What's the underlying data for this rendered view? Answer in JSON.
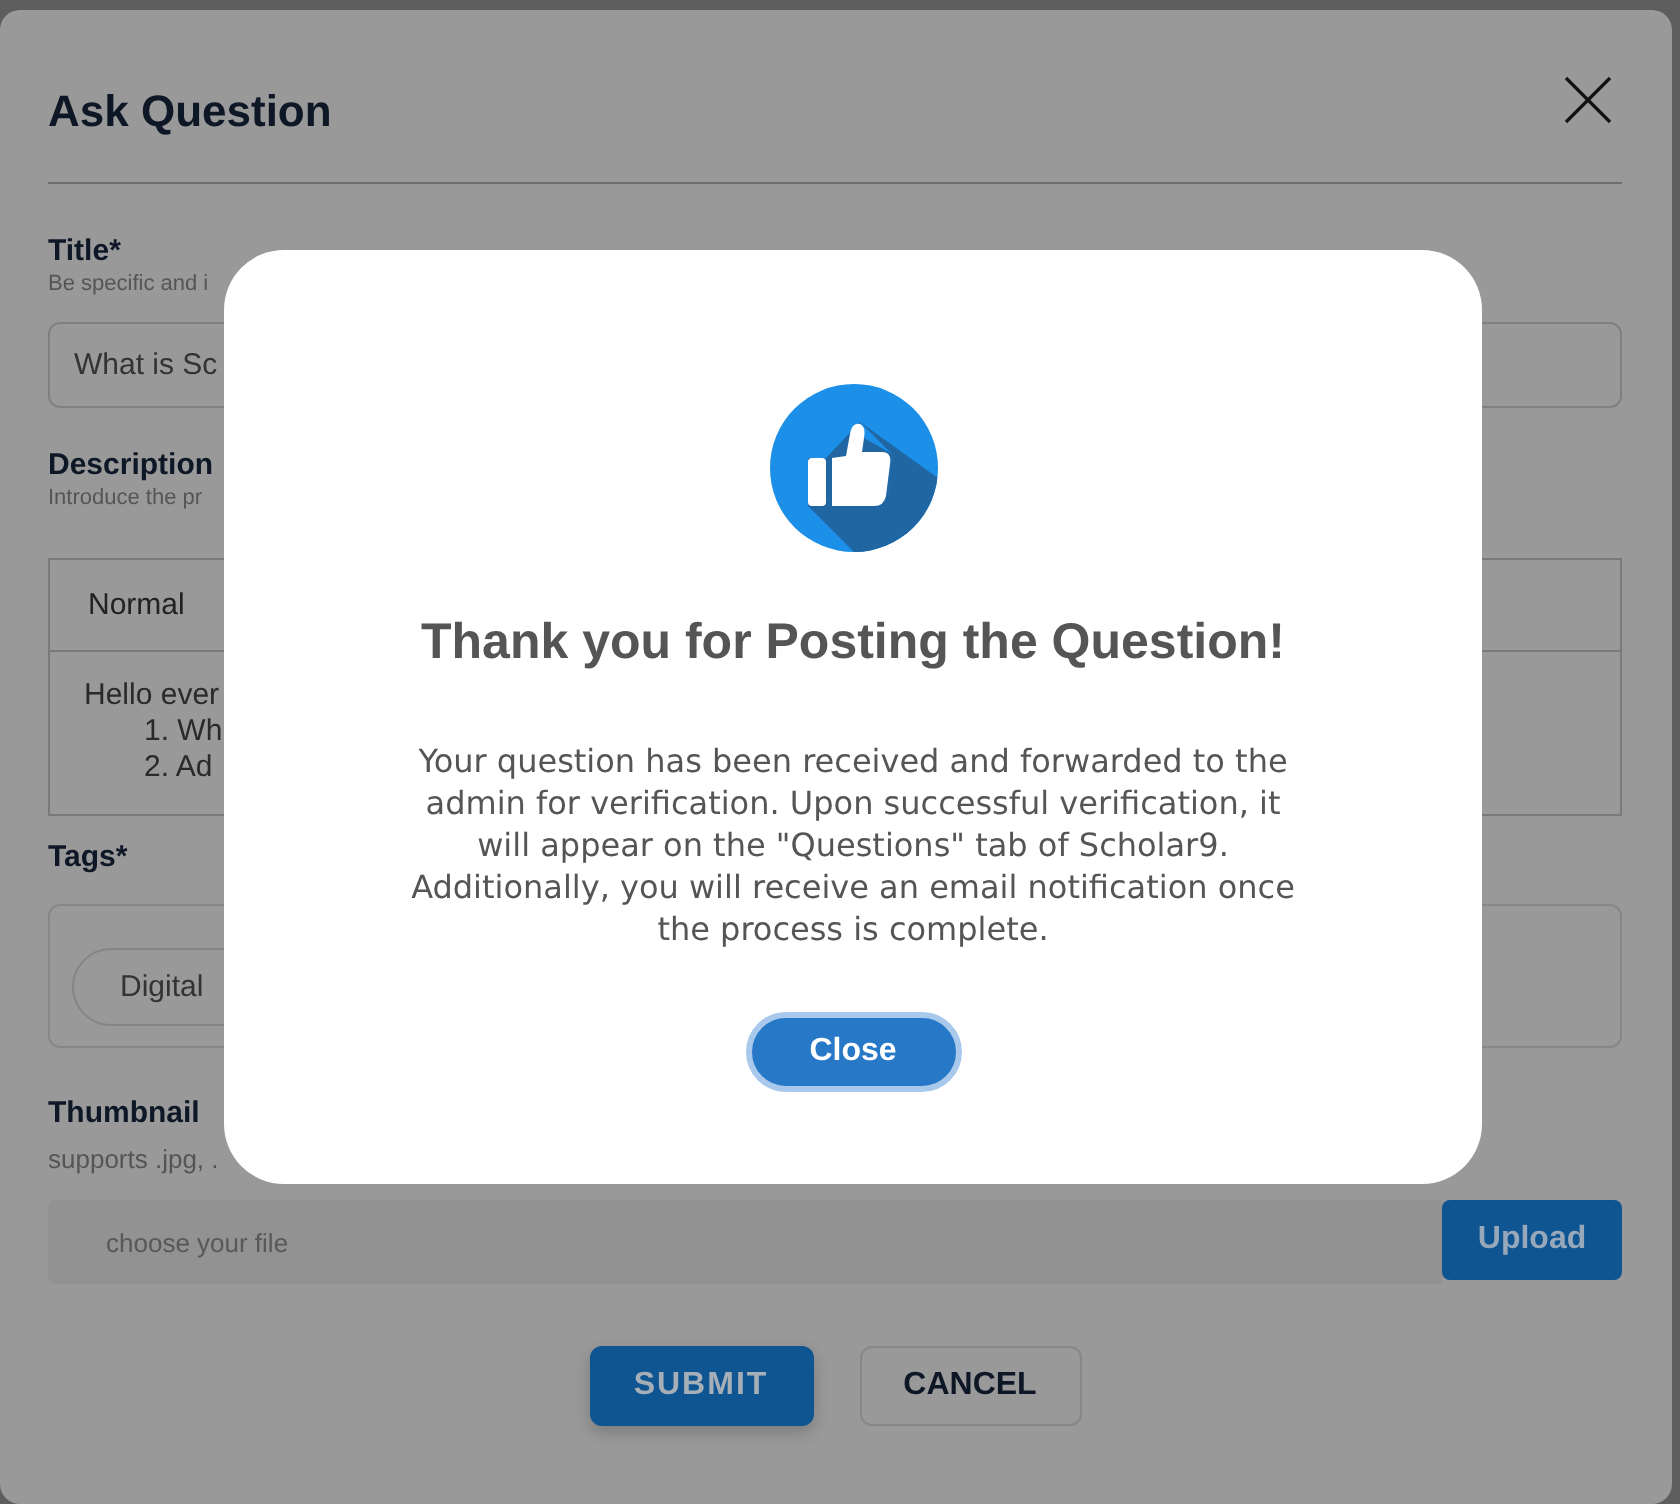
{
  "dialog": {
    "title": "Ask Question"
  },
  "title_field": {
    "label": "Title*",
    "hint": "Be specific and i",
    "value": "What is Sc"
  },
  "description_field": {
    "label": "Description",
    "hint": "Introduce the pr",
    "format": "Normal",
    "lines": [
      {
        "kind": "paragraph",
        "text": "Hello ever"
      },
      {
        "kind": "list_item",
        "text": "1. Wh"
      },
      {
        "kind": "list_item",
        "text": "2. Ad"
      }
    ]
  },
  "tags_field": {
    "label": "Tags*",
    "tags": [
      "Digital"
    ]
  },
  "thumbnail_field": {
    "label": "Thumbnail",
    "hint": "supports .jpg, .",
    "placeholder": "choose your file",
    "button": "Upload"
  },
  "actions": [
    {
      "kind": "primary",
      "label": "SUBMIT"
    },
    {
      "kind": "secondary",
      "label": "CANCEL"
    }
  ],
  "popup": {
    "heading": "Thank you for Posting the Question!",
    "message": "Your question has been received and forwarded to the admin for verification. Upon successful verification, it will appear on the \"Questions\" tab of Scholar9. Additionally, you will receive an email notification once the process is complete.",
    "button": "Close"
  }
}
